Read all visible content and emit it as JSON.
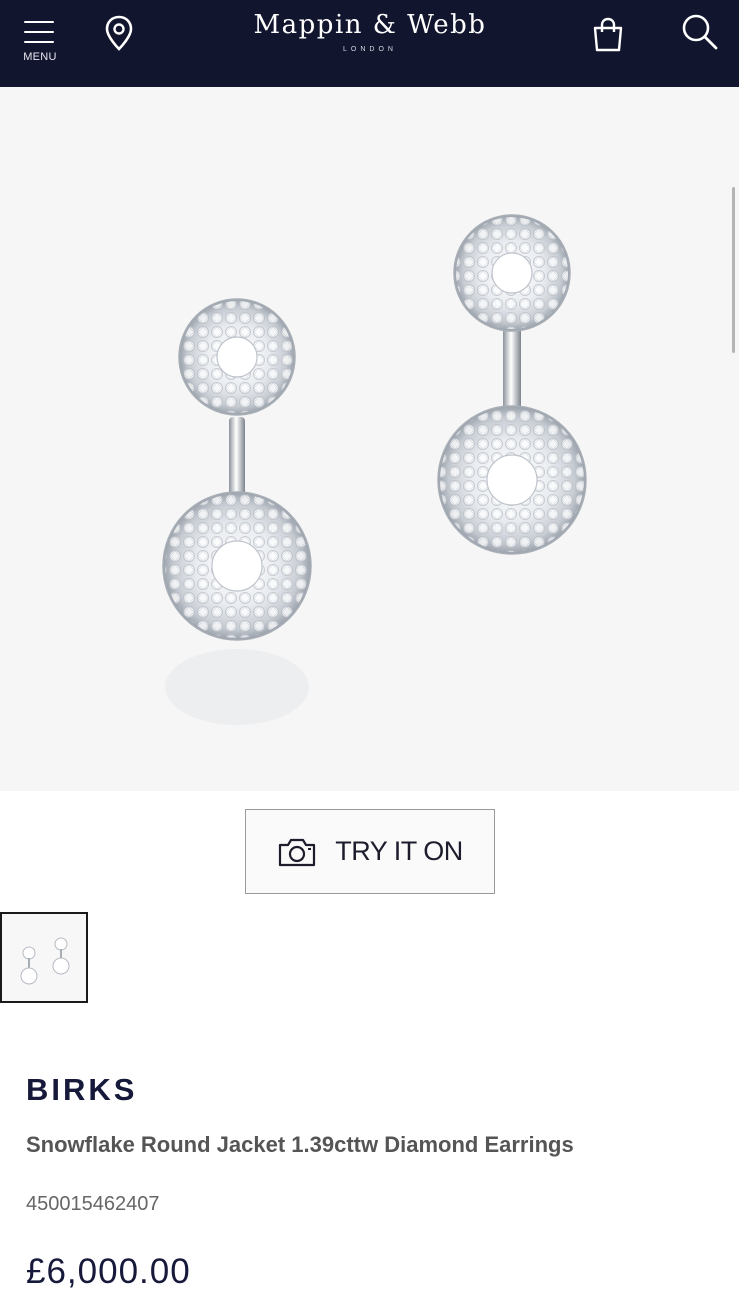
{
  "header": {
    "menu_label": "MENU",
    "brand_name": "Mappin & Webb",
    "brand_sub": "LONDON",
    "icons": [
      "hamburger-menu-icon",
      "location-pin-icon",
      "shopping-bag-icon",
      "search-icon"
    ],
    "background_color": "#12152e"
  },
  "product_image": {
    "alt": "Snowflake Round Jacket 1.39cttw Diamond Earrings"
  },
  "try_on": {
    "label": "TRY IT ON",
    "icon": "camera-icon"
  },
  "thumbnails": [
    {
      "selected": true
    }
  ],
  "product": {
    "brand": "BIRKS",
    "name": "Snowflake Round Jacket 1.39cttw Diamond Earrings",
    "sku": "450015462407",
    "price": "£6,000.00"
  },
  "colors": {
    "brand_navy": "#12152e",
    "text_navy": "#16193a",
    "hero_bg": "#f6f6f6"
  }
}
